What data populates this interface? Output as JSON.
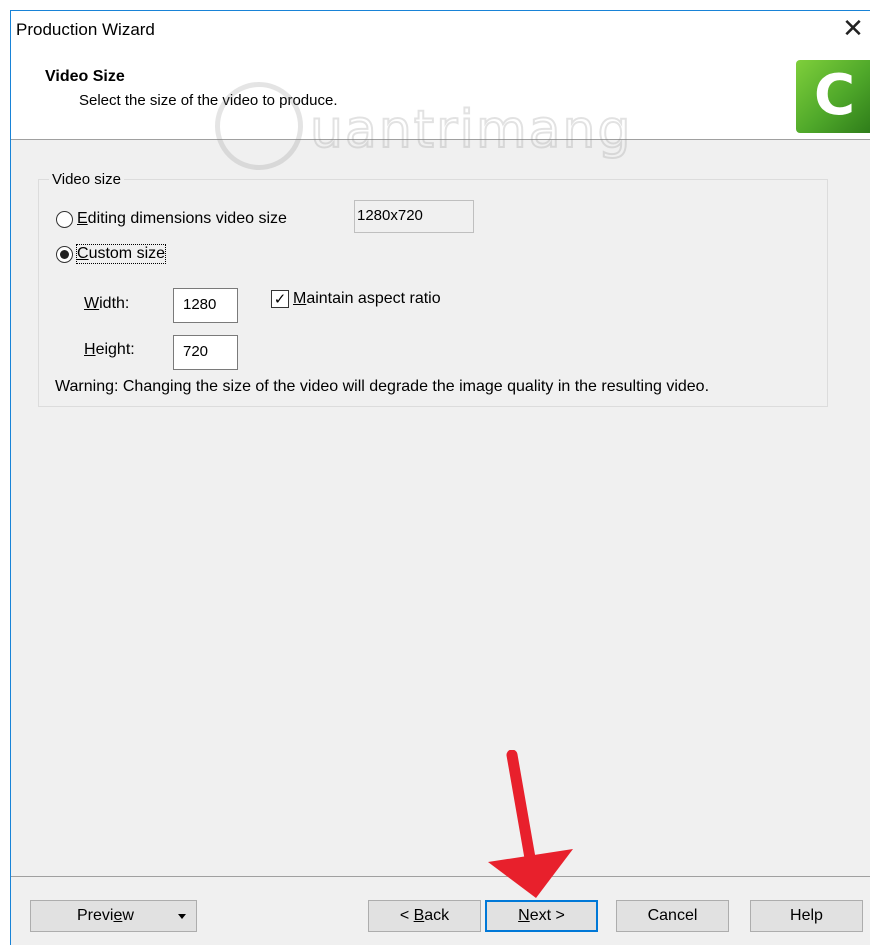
{
  "window": {
    "title": "Production Wizard",
    "close_glyph": "✕"
  },
  "header": {
    "title": "Video Size",
    "subtitle": "Select the size of the video to produce.",
    "logo_letter": "C",
    "logo_icon": "camtasia-logo-icon"
  },
  "watermark": {
    "text": "uantrimang"
  },
  "video_size": {
    "legend": "Video size",
    "option_editing": {
      "label_first": "E",
      "label_rest": "diting dimensions video size",
      "selected": false
    },
    "editing_value": "1280x720",
    "option_custom": {
      "label_first": "C",
      "label_rest": "ustom size",
      "selected": true
    },
    "width_label_first": "W",
    "width_label_rest": "idth:",
    "width_value": "1280",
    "height_label_first": "H",
    "height_label_rest": "eight:",
    "height_value": "720",
    "maintain_aspect": {
      "label_first": "M",
      "label_rest": "aintain aspect ratio",
      "checked": true,
      "check_glyph": "✓"
    },
    "warning": "Warning: Changing the size of the video will degrade the image quality in the resulting video."
  },
  "footer": {
    "preview_first": "Previ",
    "preview_ul": "e",
    "preview_rest": "w",
    "back_prefix": "< ",
    "back_first": "B",
    "back_rest": "ack",
    "next_first": "N",
    "next_rest": "ext >",
    "cancel_label": "Cancel",
    "help_label": "Help"
  },
  "colors": {
    "window_border": "#1883d7",
    "dialog_bg": "#f0f0f0",
    "primary_button_border": "#0078d7",
    "annotation_arrow": "#e8202c",
    "logo_green": "#4fa82a"
  }
}
